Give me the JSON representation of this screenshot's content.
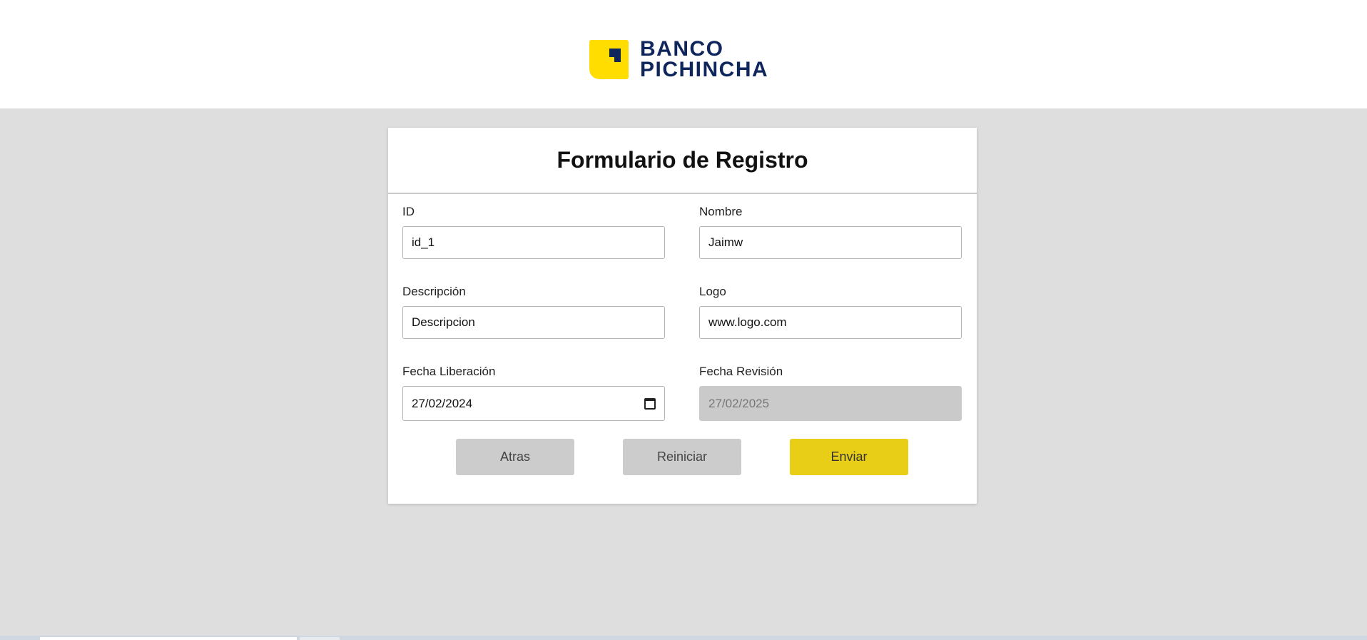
{
  "brand": {
    "line1": "BANCO",
    "line2": "PICHINCHA",
    "accent_color": "#ffdd00",
    "brand_color": "#0f265c"
  },
  "form": {
    "title": "Formulario de Registro",
    "fields": {
      "id": {
        "label": "ID",
        "value": "id_1"
      },
      "nombre": {
        "label": "Nombre",
        "value": "Jaimw"
      },
      "descripcion": {
        "label": "Descripción",
        "value": "Descripcion"
      },
      "logo": {
        "label": "Logo",
        "value": "www.logo.com"
      },
      "fecha_liberacion": {
        "label": "Fecha Liberación",
        "value": "27/02/2024"
      },
      "fecha_revision": {
        "label": "Fecha Revisión",
        "value": "27/02/2025"
      }
    },
    "buttons": {
      "back": "Atras",
      "reset": "Reiniciar",
      "send": "Enviar"
    }
  },
  "colors": {
    "background": "#dedede",
    "button_primary": "#e8ce17",
    "button_secondary": "#cccccc",
    "disabled_field": "#cacaca"
  }
}
